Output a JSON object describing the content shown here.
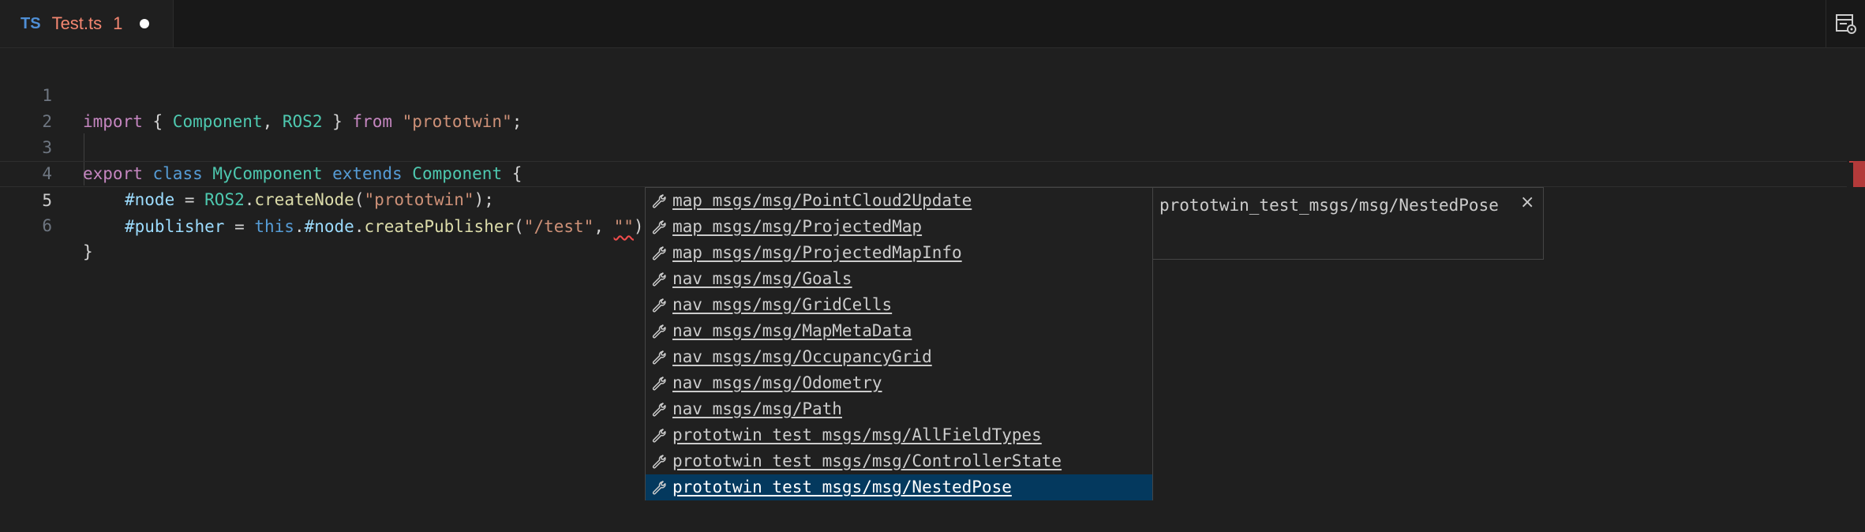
{
  "tab": {
    "lang_badge": "TS",
    "file_name": "Test.ts",
    "problem_count": "1"
  },
  "editor": {
    "line_numbers": [
      "1",
      "2",
      "3",
      "4",
      "5",
      "6"
    ],
    "lines": {
      "l1": {
        "import": "import",
        "b1": " { ",
        "component": "Component",
        "comma": ", ",
        "ros2": "ROS2",
        "b2": " } ",
        "from": "from",
        "sp": " ",
        "mod": "\"prototwin\"",
        "semi": ";"
      },
      "l3": {
        "export": "export",
        "sp1": " ",
        "class": "class",
        "sp2": " ",
        "name": "MyComponent",
        "sp3": " ",
        "extends": "extends",
        "sp4": " ",
        "base": "Component",
        "brace": " {"
      },
      "l4": {
        "field": "#node",
        "eq": " = ",
        "ros2": "ROS2",
        "dot": ".",
        "fn": "createNode",
        "open": "(",
        "arg": "\"prototwin\"",
        "close": ");"
      },
      "l5": {
        "field": "#publisher",
        "eq": " = ",
        "this": "this",
        "dot1": ".",
        "node": "#node",
        "dot2": ".",
        "fn": "createPublisher",
        "open": "(",
        "arg1": "\"/test\"",
        "comma": ", ",
        "arg2": "\"\"",
        "close": ");"
      },
      "l6": {
        "brace": "}"
      }
    }
  },
  "suggest": {
    "items": [
      "map_msgs/msg/PointCloud2Update",
      "map_msgs/msg/ProjectedMap",
      "map_msgs/msg/ProjectedMapInfo",
      "nav_msgs/msg/Goals",
      "nav_msgs/msg/GridCells",
      "nav_msgs/msg/MapMetaData",
      "nav_msgs/msg/OccupancyGrid",
      "nav_msgs/msg/Odometry",
      "nav_msgs/msg/Path",
      "prototwin_test_msgs/msg/AllFieldTypes",
      "prototwin_test_msgs/msg/ControllerState",
      "prototwin_test_msgs/msg/NestedPose"
    ],
    "selected_index": 11,
    "item_icon": "wrench-icon",
    "details_text": "prototwin_test_msgs/msg/NestedPose",
    "close_glyph": "×"
  },
  "colors": {
    "selected_bg": "#04395e",
    "error": "#f48771"
  }
}
